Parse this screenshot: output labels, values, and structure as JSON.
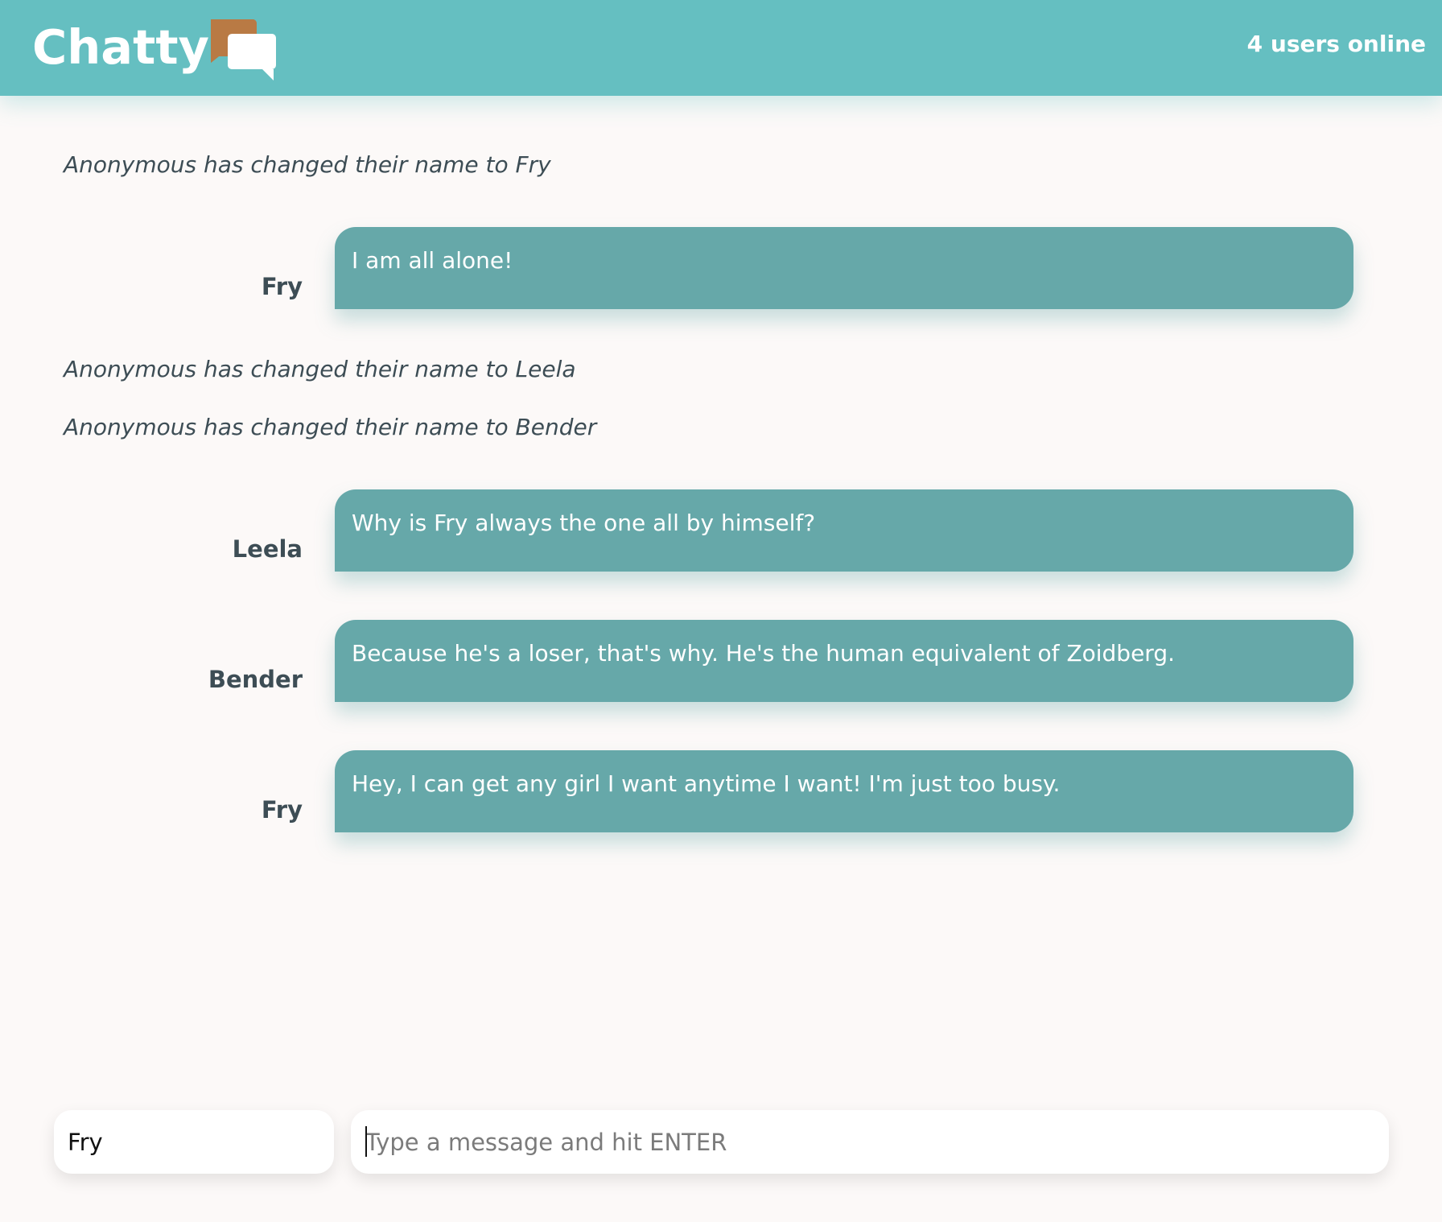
{
  "header": {
    "title": "Chatty",
    "logo_icon": "chat-bubbles-icon",
    "online_status": "4 users online",
    "colors": {
      "bar": "#65bfc1",
      "logo_back": "#b97a44",
      "logo_front": "#ffffff"
    }
  },
  "feed": {
    "system_messages": [
      "Anonymous has changed their name to Fry",
      "Anonymous has changed their name to Leela",
      "Anonymous has changed their name to Bender"
    ],
    "messages": [
      {
        "author": "Fry",
        "text": "I am all alone!"
      },
      {
        "author": "Leela",
        "text": "Why is Fry always the one all by himself?"
      },
      {
        "author": "Bender",
        "text": "Because he's a loser, that's why. He's the human equivalent of Zoidberg."
      },
      {
        "author": "Fry",
        "text": "Hey, I can get any girl I want anytime I want! I'm just too busy."
      }
    ],
    "bubble_color": "#66a8a9"
  },
  "composer": {
    "name_value": "Fry",
    "message_placeholder": "Type a message and hit ENTER",
    "message_value": ""
  }
}
